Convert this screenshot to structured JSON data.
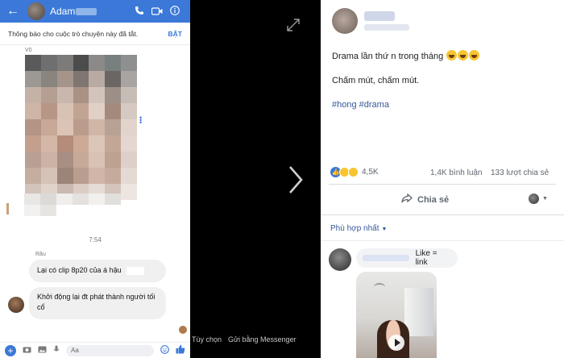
{
  "messenger": {
    "header": {
      "back_icon": "arrow-left-icon",
      "contact_name": "Adam",
      "icons": [
        "phone-icon",
        "video-camera-icon",
        "info-icon"
      ]
    },
    "notification": {
      "text": "Thông báo cho cuộc trò chuyện này đã tắt.",
      "action": "BẬT"
    },
    "image_label": "V0",
    "timestamp": "7:54",
    "sender_label": "Râu",
    "messages": [
      {
        "text": "Lại có clip 8p20 của á hậu"
      },
      {
        "text": "Khởi động lại đt phát thành người tối cổ"
      }
    ],
    "composer": {
      "placeholder": "Aa",
      "icons": [
        "plus-icon",
        "camera-icon",
        "image-icon",
        "microphone-icon",
        "emoji-icon",
        "thumbs-up-icon"
      ]
    }
  },
  "viewer": {
    "expand_icon": "expand-icon",
    "next_icon": "chevron-right-icon",
    "options_label": "Tùy chọn",
    "send_messenger_label": "Gửi bằng Messenger"
  },
  "post": {
    "text_line1": "Drama lần thứ n trong tháng",
    "text_line2": "Chấm mút, chấm mút.",
    "hashtags": "#hong #drama",
    "reactions_count": "4,5K",
    "comments_count": "1,4K bình luận",
    "shares_count": "133 lượt chia sẻ",
    "share_button": "Chia sẻ",
    "sort_label": "Phù hợp nhất",
    "comment": {
      "text": "Like = link"
    }
  },
  "colors": {
    "messenger_blue": "#3b78d8",
    "facebook_link": "#365899"
  }
}
